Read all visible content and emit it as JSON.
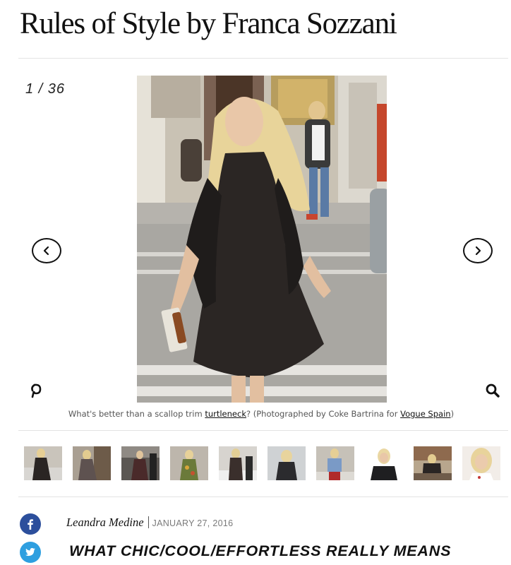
{
  "article": {
    "title": "Rules of Style by Franca Sozzani"
  },
  "slideshow": {
    "counter": "1 / 36",
    "prev_icon": "chevron-left-icon",
    "next_icon": "chevron-right-icon",
    "caption": {
      "before": "What's better than a scallop trim ",
      "link1": "turtleneck",
      "middle": "? (Photographed by Coke Bartrina for ",
      "link2": "Vogue Spain",
      "after": ")"
    },
    "thumbnail_count": 10
  },
  "share": {
    "pinterest_icon": "pinterest-icon",
    "zoom_icon": "magnifier-icon",
    "facebook_icon": "facebook-icon",
    "twitter_icon": "twitter-icon",
    "facebook_color": "#2c4f9c",
    "twitter_color": "#2e9fe0"
  },
  "byline": {
    "author": "Leandra Medine",
    "date": "JANUARY 27, 2016"
  },
  "headline": "WHAT CHIC/COOL/EFFORTLESS REALLY MEANS"
}
